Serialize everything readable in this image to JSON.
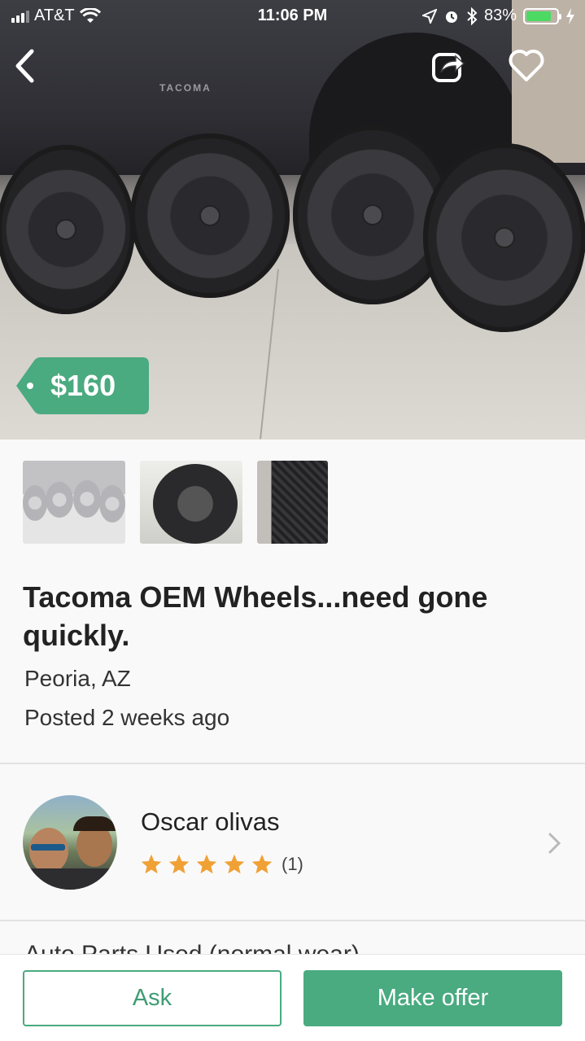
{
  "status_bar": {
    "carrier": "AT&T",
    "time": "11:06 PM",
    "battery": "83%",
    "battery_level": 0.83
  },
  "hero": {
    "vehicle_badge": "TACOMA",
    "price": "$160"
  },
  "colors": {
    "accent": "#4aaa80",
    "star": "#f0a135"
  },
  "listing": {
    "title": "Tacoma OEM Wheels...need gone quickly.",
    "location": "Peoria, AZ",
    "posted": "Posted 2 weeks ago"
  },
  "seller": {
    "name": "Oscar olivas",
    "rating_stars": 5,
    "review_count": "(1)"
  },
  "category_peek": "Auto Parts Used (normal wear)",
  "actions": {
    "ask_label": "Ask",
    "offer_label": "Make offer"
  }
}
